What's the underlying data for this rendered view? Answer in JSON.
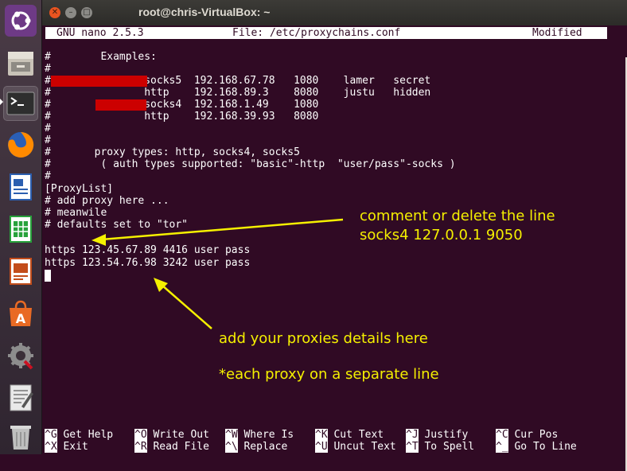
{
  "window": {
    "title": "root@chris-VirtualBox: ~"
  },
  "launcher": {
    "items": [
      {
        "name": "ubuntu-logo-icon",
        "color": "#e95420"
      },
      {
        "name": "files-icon",
        "color": "#c9c3b8"
      },
      {
        "name": "terminal-icon",
        "color": "#2e2e2e"
      },
      {
        "name": "firefox-icon",
        "color": "#ff9500"
      },
      {
        "name": "writer-icon",
        "color": "#2b5fb0"
      },
      {
        "name": "calc-icon",
        "color": "#27a23b"
      },
      {
        "name": "impress-icon",
        "color": "#c34d1b"
      },
      {
        "name": "software-center-icon",
        "color": "#e96a24"
      },
      {
        "name": "settings-icon",
        "color": "#9a9a9a"
      },
      {
        "name": "text-editor-icon",
        "color": "#dcdcdc"
      },
      {
        "name": "trash-icon",
        "color": "#bfbfbf"
      }
    ]
  },
  "nano": {
    "version": "GNU nano 2.5.3",
    "file": "File: /etc/proxychains.conf",
    "status": "Modified",
    "lines": [
      "#        Examples:",
      "#",
      "#               socks5  192.168.67.78   1080    lamer   secret",
      "#               http    192.168.89.3    8080    justu   hidden",
      "#               socks4  192.168.1.49    1080",
      "#               http    192.168.39.93   8080",
      "#",
      "#",
      "#       proxy types: http, socks4, socks5",
      "#        ( auth types supported: \"basic\"-http  \"user/pass\"-socks )",
      "#",
      "[ProxyList]",
      "# add proxy here ...",
      "# meanwile",
      "# defaults set to \"tor\"",
      "",
      "https 123.45.67.89 4416 user pass",
      "https 123.54.76.98 3242 user pass"
    ],
    "shortcuts": [
      {
        "key": "^G",
        "label": "Get Help"
      },
      {
        "key": "^O",
        "label": "Write Out"
      },
      {
        "key": "^W",
        "label": "Where Is"
      },
      {
        "key": "^K",
        "label": "Cut Text"
      },
      {
        "key": "^J",
        "label": "Justify"
      },
      {
        "key": "^C",
        "label": "Cur Pos"
      },
      {
        "key": "^X",
        "label": "Exit"
      },
      {
        "key": "^R",
        "label": "Read File"
      },
      {
        "key": "^\\",
        "label": "Replace"
      },
      {
        "key": "^U",
        "label": "Uncut Text"
      },
      {
        "key": "^T",
        "label": "To Spell"
      },
      {
        "key": "^_",
        "label": "Go To Line"
      }
    ]
  },
  "annotations": {
    "comment_line1": "comment or delete the line",
    "comment_line2": "socks4 127.0.0.1 9050",
    "add_proxies": "add your proxies details here",
    "each_proxy": "*each proxy on a separate line",
    "color": "#f5f000"
  }
}
